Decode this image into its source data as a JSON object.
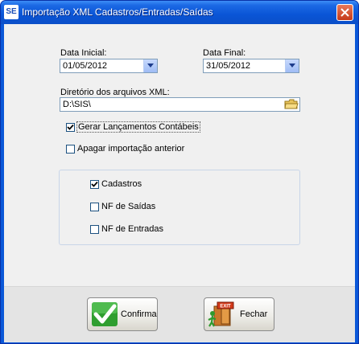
{
  "window": {
    "app_icon_text": "SE",
    "title": "Importação XML Cadastros/Entradas/Saídas"
  },
  "form": {
    "data_inicial_label": "Data Inicial:",
    "data_inicial_value": "01/05/2012",
    "data_final_label": "Data Final:",
    "data_final_value": "31/05/2012",
    "diretorio_label": "Diretório dos arquivos XML:",
    "diretorio_value": "D:\\SIS\\",
    "gerar_lancamentos_label": "Gerar Lançamentos Contábeis",
    "gerar_lancamentos_checked": true,
    "apagar_importacao_label": "Apagar importação anterior",
    "apagar_importacao_checked": false
  },
  "group": {
    "options": [
      {
        "label": "Cadastros",
        "checked": true
      },
      {
        "label": "NF de Saídas",
        "checked": false
      },
      {
        "label": "NF de Entradas",
        "checked": false
      }
    ]
  },
  "buttons": {
    "confirma_label": "Confirma",
    "fechar_label": "Fechar",
    "exit_sign_text": "EXIT"
  },
  "colors": {
    "titlebar": "#0a55d6",
    "client_bg": "#f0f0f0",
    "footer_bg": "#e4e4e4"
  }
}
